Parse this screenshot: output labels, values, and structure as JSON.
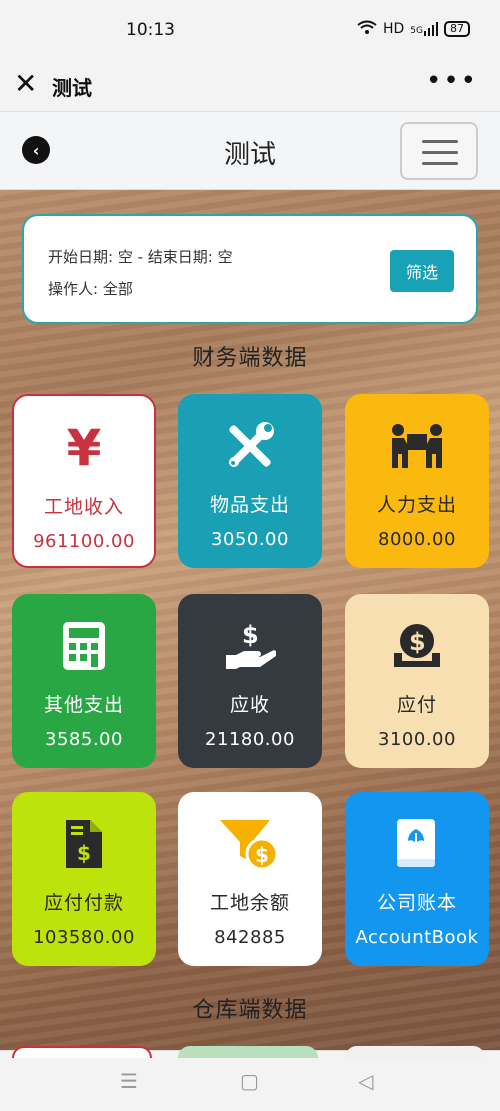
{
  "status": {
    "time": "10:13",
    "network": "HD",
    "signal": "5G",
    "battery": "87"
  },
  "wx": {
    "title": "测试",
    "more": "•••"
  },
  "app": {
    "title": "测试"
  },
  "filter": {
    "line1": "开始日期: 空 - 结束日期: 空",
    "line2": "操作人: 全部",
    "button": "筛选"
  },
  "sections": {
    "finance": "财务端数据",
    "warehouse": "仓库端数据"
  },
  "cards": [
    {
      "name": "工地收入",
      "value": "961100.00",
      "icon": "yuan-icon",
      "bg": "#ffffff",
      "fg": "#c8323e",
      "border": "#c8323e"
    },
    {
      "name": "物品支出",
      "value": "3050.00",
      "icon": "tools-icon",
      "bg": "#1aa0b4",
      "fg": "#ffffff",
      "border": "#1aa0b4"
    },
    {
      "name": "人力支出",
      "value": "8000.00",
      "icon": "movers-icon",
      "bg": "#fbb80f",
      "fg": "#2a2a2a",
      "border": "#fbb80f"
    },
    {
      "name": "其他支出",
      "value": "3585.00",
      "icon": "calculator-icon",
      "bg": "#29a745",
      "fg": "#ffffff",
      "border": "#29a745"
    },
    {
      "name": "应收",
      "value": "21180.00",
      "icon": "money-hand-icon",
      "bg": "#343a40",
      "fg": "#ffffff",
      "border": "#343a40"
    },
    {
      "name": "应付",
      "value": "3100.00",
      "icon": "coin-tray-icon",
      "bg": "#f7dfb2",
      "fg": "#2a2a2a",
      "border": "#f7dfb2"
    },
    {
      "name": "应付付款",
      "value": "103580.00",
      "icon": "invoice-icon",
      "bg": "#bde20c",
      "fg": "#2a2a2a",
      "border": "#bde20c"
    },
    {
      "name": "工地余额",
      "value": "842885",
      "icon": "funnel-coin-icon",
      "bg": "#ffffff",
      "fg": "#2a2a2a",
      "border": "#ffffff"
    },
    {
      "name": "公司账本",
      "value": "AccountBook",
      "icon": "book-icon",
      "bg": "#1296f0",
      "fg": "#ffffff",
      "border": "#1296f0"
    }
  ]
}
